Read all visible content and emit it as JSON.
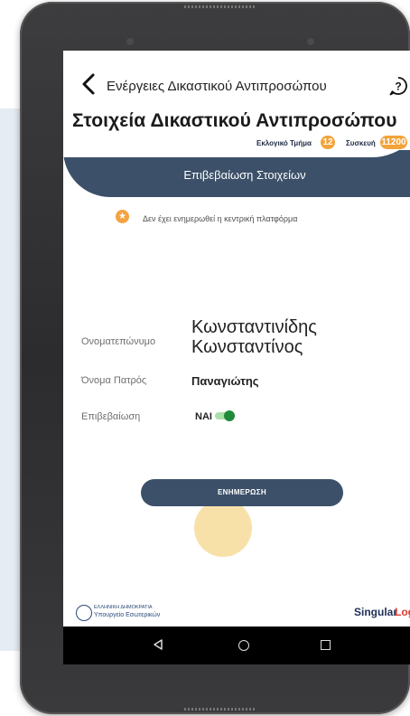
{
  "header": {
    "back_title": "Ενέργειες Δικαστικού Αντιπροσώπου",
    "page_title": "Στοιχεία Δικαστικού Αντιπροσώπου",
    "section_label": "Εκλογικό Τμήμα",
    "section_number": "12",
    "device_label": "Συσκευή",
    "device_number": "11200",
    "confirm_header": "Επιβεβαίωση Στοιχείων"
  },
  "warning": {
    "text": "Δεν έχει ενημερωθεί η κεντρική πλατφόρμα",
    "icon": "star-icon"
  },
  "details": {
    "fullname_label": "Ονοματεπώνυμο",
    "fullname_line1": "Κωνσταντινίδης",
    "fullname_line2": "Κωνσταντίνος",
    "father_label": "Όνομα Πατρός",
    "father_value": "Παναγιώτης",
    "confirm_label": "Επιβεβαίωση",
    "confirm_value": "ΝΑΙ",
    "toggle_on": true
  },
  "actions": {
    "update_label": "ΕΝΗΜΕΡΩΣΗ"
  },
  "footer": {
    "gov_line1": "ΕΛΛΗΝΙΚΗ ΔΗΜΟΚΡΑΤΙΑ",
    "gov_line2": "Υπουργείο Εσωτερικών",
    "brand_singular": "Singular",
    "brand_logic": "Logic"
  },
  "colors": {
    "header_dark": "#3c5069",
    "accent_orange": "#f2a33a",
    "toggle_green": "#1f8b3a",
    "brand_red": "#e03b2f"
  }
}
